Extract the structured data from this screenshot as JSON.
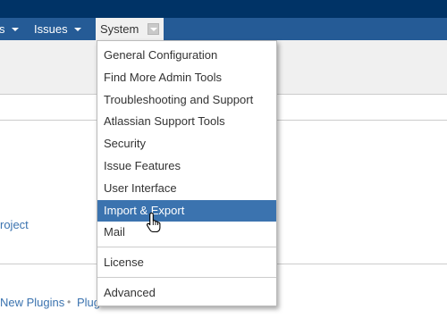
{
  "nav": {
    "items": [
      {
        "label": "s"
      },
      {
        "label": "Issues"
      },
      {
        "label": "System"
      }
    ]
  },
  "content": {
    "project_link": "roject",
    "footer_links": [
      "New Plugins",
      "Plug"
    ]
  },
  "system_menu": {
    "items": [
      "General Configuration",
      "Find More Admin Tools",
      "Troubleshooting and Support",
      "Atlassian Support Tools",
      "Security",
      "Issue Features",
      "User Interface",
      "Import & Export",
      "Mail",
      "License",
      "Advanced"
    ],
    "highlighted": "Import & Export"
  },
  "colors": {
    "topbar": "#003366",
    "navbar": "#255b96",
    "highlight": "#3b73af",
    "link": "#3b73af"
  }
}
